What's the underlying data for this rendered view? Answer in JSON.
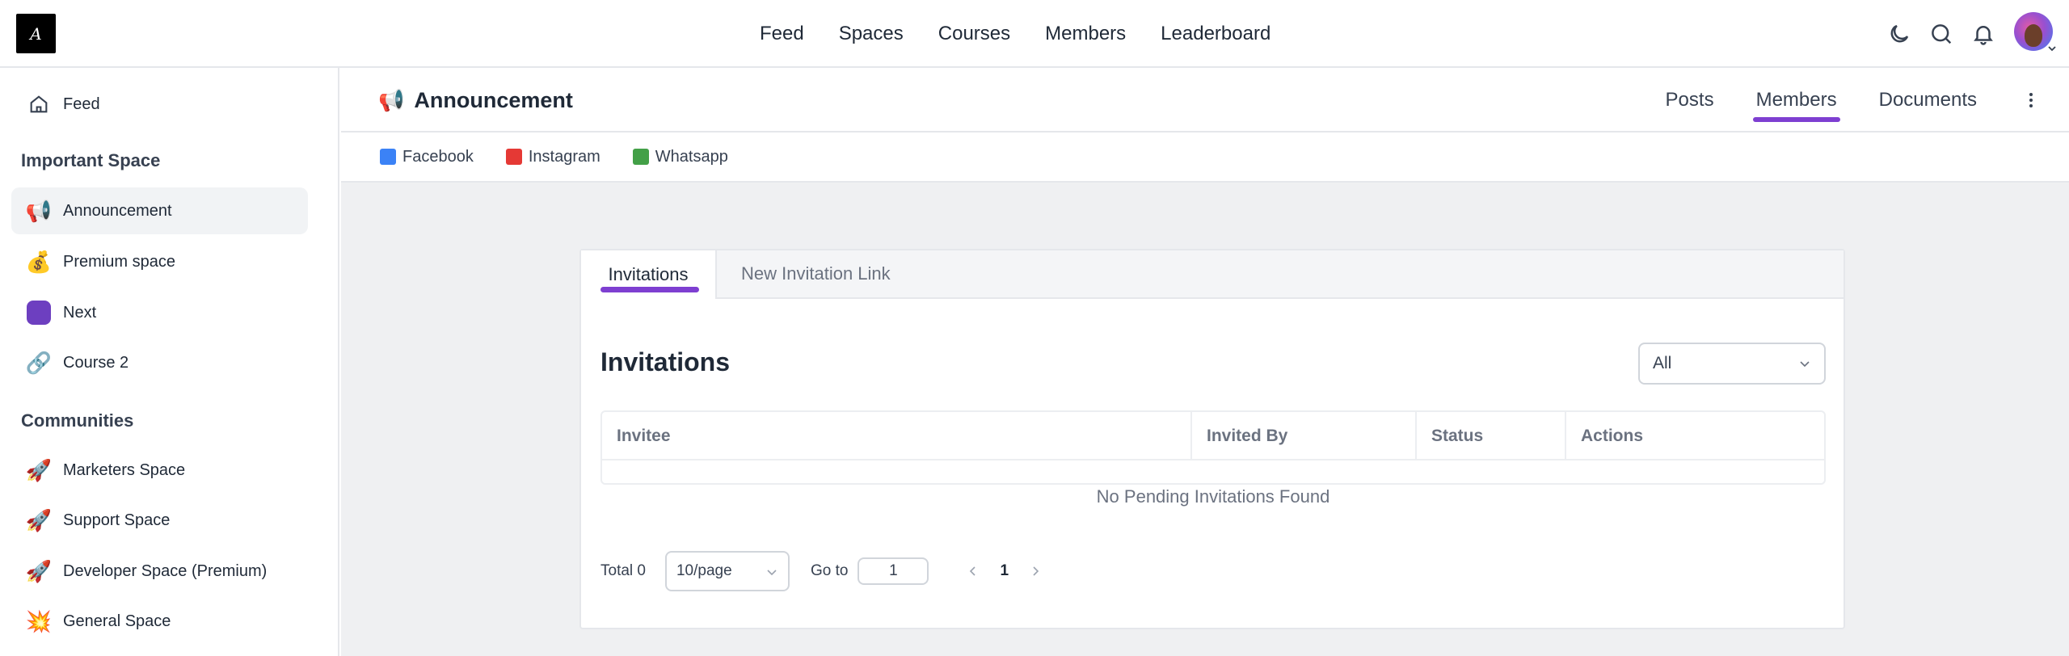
{
  "topnav": {
    "items": [
      "Feed",
      "Spaces",
      "Courses",
      "Members",
      "Leaderboard"
    ]
  },
  "sidebar": {
    "feed_label": "Feed",
    "group1_heading": "Important Space",
    "group1": [
      {
        "label": "Announcement",
        "icon": "megaphone-icon",
        "glyph": "📢"
      },
      {
        "label": "Premium space",
        "icon": "money-bag-icon",
        "glyph": "💰"
      },
      {
        "label": "Next",
        "icon": "purple-square-icon",
        "glyph": ""
      },
      {
        "label": "Course 2",
        "icon": "link-icon",
        "glyph": "🔗"
      }
    ],
    "group2_heading": "Communities",
    "group2": [
      {
        "label": "Marketers Space",
        "icon": "rocket-icon",
        "glyph": "🚀"
      },
      {
        "label": "Support Space",
        "icon": "rocket-icon",
        "glyph": "🚀"
      },
      {
        "label": "Developer Space (Premium)",
        "icon": "rocket-icon",
        "glyph": "🚀"
      },
      {
        "label": "General Space",
        "icon": "explosion-icon",
        "glyph": "💥"
      }
    ]
  },
  "space": {
    "emoji": "📢",
    "title": "Announcement",
    "tabs": [
      "Posts",
      "Members",
      "Documents"
    ],
    "active_tab": "Members"
  },
  "links": [
    {
      "label": "Facebook",
      "color": "#3b82f6"
    },
    {
      "label": "Instagram",
      "color": "#e53935"
    },
    {
      "label": "Whatsapp",
      "color": "#43a047"
    }
  ],
  "panel": {
    "tabs": [
      "Invitations",
      "New Invitation Link"
    ],
    "title": "Invitations",
    "filter_value": "All",
    "columns": [
      "Invitee",
      "Invited By",
      "Status",
      "Actions"
    ],
    "empty_text": "No Pending Invitations Found",
    "pager": {
      "total_label": "Total 0",
      "page_size": "10/page",
      "goto_label": "Go to",
      "goto_value": "1",
      "current_page": "1"
    }
  },
  "colors": {
    "accent": "#7e3fd1",
    "main_bg": "#eff0f2"
  }
}
